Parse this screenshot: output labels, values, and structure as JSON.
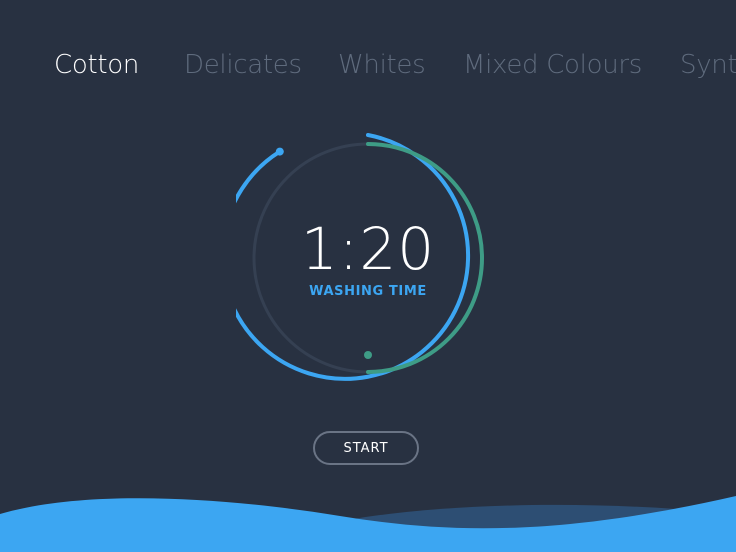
{
  "program_tabs": [
    {
      "label": "Cotton",
      "active": true
    },
    {
      "label": "Delicates",
      "active": false
    },
    {
      "label": "Whites",
      "active": false
    },
    {
      "label": "Mixed Colours",
      "active": false
    },
    {
      "label": "Synth",
      "active": false
    }
  ],
  "timer": {
    "time": "1:20",
    "label": "WASHING TIME"
  },
  "start_button": {
    "label": "START"
  },
  "colors": {
    "background": "#283141",
    "accent_blue": "#3ca6f2",
    "accent_green": "#3e9c86",
    "track": "#354052",
    "inactive_text": "#5f6b7d"
  }
}
